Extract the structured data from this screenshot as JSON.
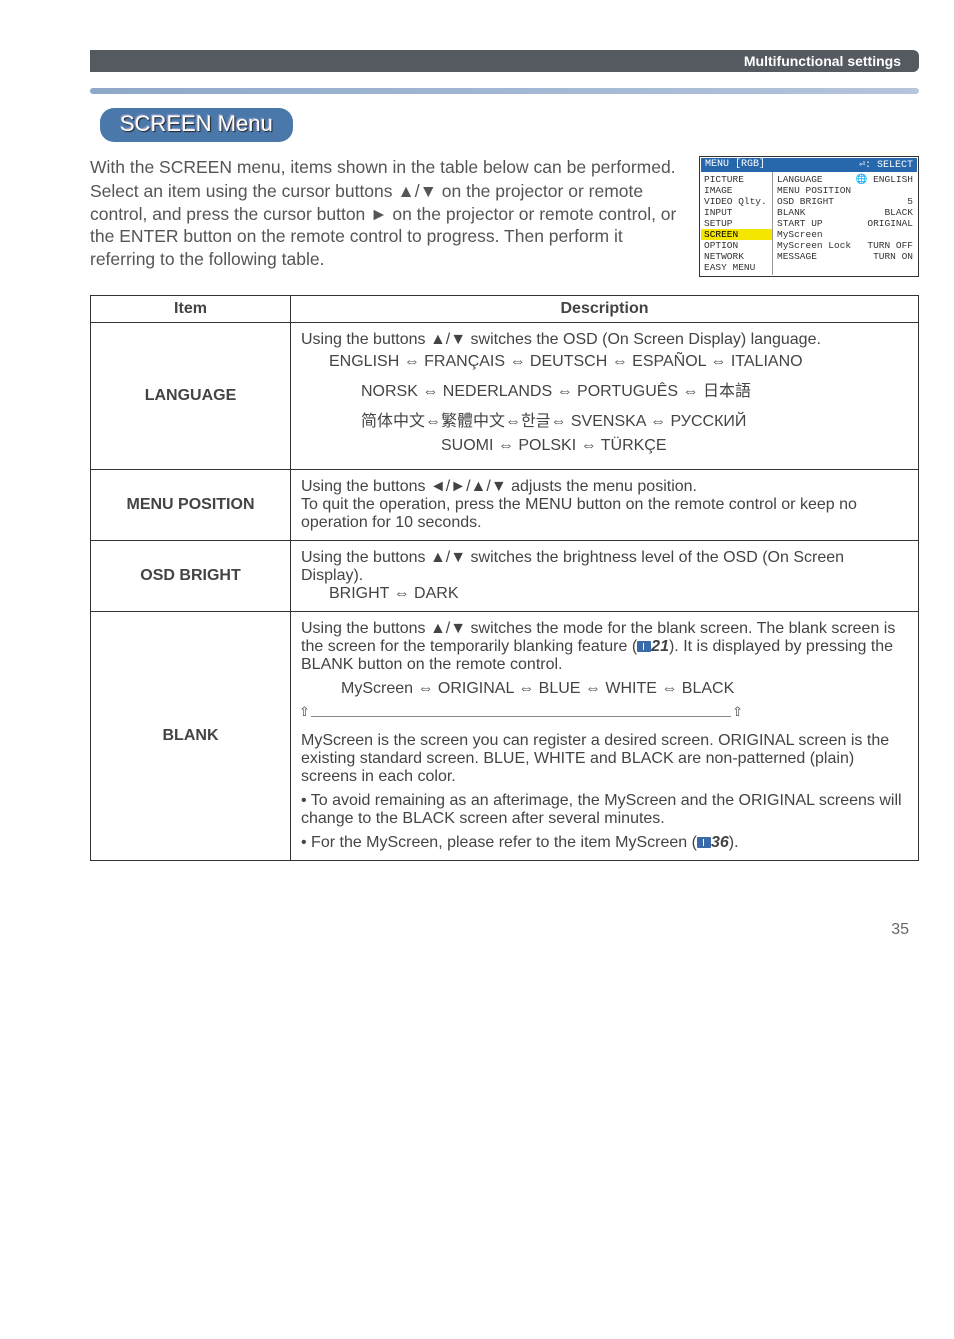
{
  "header": {
    "section_label": "Multifunctional settings"
  },
  "pill": {
    "text": "SCREEN Menu"
  },
  "intro": {
    "p1": "With the SCREEN menu, items shown in the table below can be performed.",
    "p2": "Select an item using the cursor buttons ▲/▼ on the projector or remote control, and press the cursor button ► on the projector or remote control, or the ENTER button on the remote control to progress. Then perform it referring to the following table."
  },
  "menu_shot": {
    "header_left": "MENU [RGB]",
    "header_right": "⏎: SELECT",
    "left_items": [
      "PICTURE",
      "IMAGE",
      "VIDEO Qlty.",
      "INPUT",
      "SETUP",
      "SCREEN",
      "OPTION",
      "NETWORK",
      "EASY MENU"
    ],
    "highlight_index": 5,
    "right_rows": [
      [
        "LANGUAGE",
        "🌐 ENGLISH"
      ],
      [
        "MENU POSITION",
        ""
      ],
      [
        "OSD BRIGHT",
        "5"
      ],
      [
        "BLANK",
        "BLACK"
      ],
      [
        "START UP",
        "ORIGINAL"
      ],
      [
        "MyScreen",
        ""
      ],
      [
        "MyScreen Lock",
        "TURN OFF"
      ],
      [
        "MESSAGE",
        "TURN ON"
      ]
    ]
  },
  "table": {
    "head_item": "Item",
    "head_desc": "Description",
    "rows": {
      "language": {
        "label": "LANGUAGE",
        "line1": "Using the buttons ▲/▼ switches the OSD (On Screen Display) language.",
        "cycle1": "ENGLISH ⇔ FRANÇAIS ⇔ DEUTSCH ⇔ ESPAÑOL ⇔ ITALIANO",
        "cycle2": "NORSK ⇔ NEDERLANDS ⇔ PORTUGUÊS ⇔ 日本語",
        "cycle3": "简体中文⇔繁體中文⇔한글⇔ SVENSKA ⇔ РУССКИЙ",
        "cycle4": "SUOMI ⇔ POLSKI ⇔ TÜRKÇE"
      },
      "menu_position": {
        "label": "MENU POSITION",
        "text": "Using the buttons ◄/►/▲/▼ adjusts the menu position.\nTo quit the operation, press the MENU button on the remote control or keep no operation for 10 seconds."
      },
      "osd_bright": {
        "label": "OSD BRIGHT",
        "line1": "Using the buttons ▲/▼ switches the brightness level of the OSD (On Screen Display).",
        "cycle": "BRIGHT ⇔ DARK"
      },
      "blank": {
        "label": "BLANK",
        "p1a": "Using the buttons ▲/▼ switches the mode for the blank screen. The blank screen is the screen for the temporarily blanking feature (",
        "p1_ref": "21",
        "p1b": "). It is displayed by pressing the BLANK button on the remote control.",
        "cycle": "MyScreen ⇔ ORIGINAL ⇔ BLUE ⇔ WHITE ⇔ BLACK",
        "p2": "MyScreen is the screen you can register a desired screen. ORIGINAL screen is the existing standard screen. BLUE, WHITE and BLACK are non-patterned (plain) screens in each color.",
        "p3": "• To avoid remaining as an afterimage, the MyScreen and the ORIGINAL screens will change to the BLACK screen after several minutes.",
        "p4a": "• For the MyScreen, please refer to the item MyScreen (",
        "p4_ref": "36",
        "p4b": ")."
      }
    }
  },
  "footer": {
    "page": "35"
  }
}
